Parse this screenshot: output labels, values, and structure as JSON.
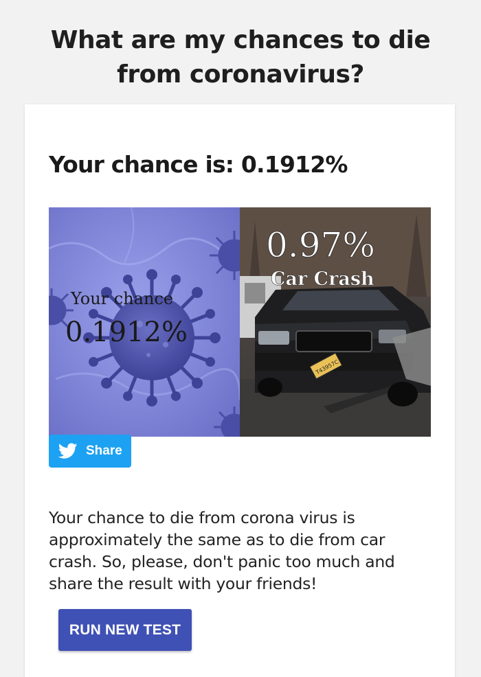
{
  "header": {
    "title_line1": "What are my chances to die",
    "title_line2": "from coronavirus?"
  },
  "result": {
    "heading": "Your chance is: 0.1912%",
    "image": {
      "left_label": "Your chance",
      "left_value": "0.1912%",
      "right_value": "0.97%",
      "right_label": "Car Crash",
      "plate_text": "T43957C"
    },
    "share_label": "Share",
    "description": "Your chance to die from corona virus is approximately the same as to die from car crash. So, please, don't panic too much and share the result with your friends!",
    "run_button_label": "RUN NEW TEST"
  },
  "colors": {
    "page_background": "#f2f2f2",
    "card_background": "#ffffff",
    "twitter_blue": "#1da1f2",
    "primary_button": "#3f51b5",
    "virus_panel": "#7e83d6"
  },
  "icons": {
    "share": "twitter-bird-icon"
  }
}
